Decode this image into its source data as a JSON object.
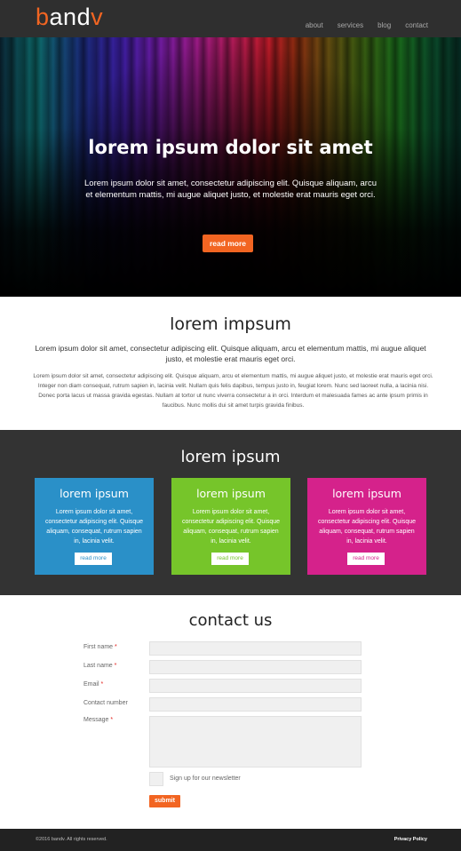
{
  "brand": {
    "logo_b": "b",
    "logo_and": "and",
    "logo_v": "v",
    "accent": "#f26522"
  },
  "nav": {
    "items": [
      "about",
      "services",
      "blog",
      "contact"
    ]
  },
  "hero": {
    "title": "lorem ipsum dolor sit amet",
    "text": "Lorem ipsum dolor sit amet, consectetur adipiscing elit. Quisque aliquam, arcu et elementum mattis, mi augue aliquet justo, et molestie erat mauris eget orci.",
    "button": "read more"
  },
  "intro": {
    "title": "lorem impsum",
    "lead": "Lorem ipsum dolor sit amet, consectetur adipiscing elit. Quisque aliquam, arcu et elementum mattis, mi augue aliquet justo, et molestie erat mauris eget orci.",
    "body": "Lorem ipsum dolor sit amet, consectetur adipiscing elit. Quisque aliquam, arcu et elementum mattis, mi augue aliquet justo, et molestie erat mauris eget orci. Integer non diam consequat, rutrum sapien in, lacinia velit. Nullam quis felis dapibus, tempus justo in, feugiat lorem. Nunc sed laoreet nulla, a lacinia nisi. Donec porta lacus ut massa gravida egestas. Nullam at tortor ut nunc viverra consectetur a in orci. Interdum et malesuada fames ac ante ipsum primis in faucibus. Nunc mollis dui sit amet turpis gravida finibus."
  },
  "services": {
    "title": "lorem ipsum",
    "cards": [
      {
        "title": "lorem ipsum",
        "text": "Lorem ipsum dolor sit amet, consectetur adipiscing elit. Quisque aliquam, consequat, rutrum sapien in, lacinia velit.",
        "button": "read more",
        "color": "#2a90c8"
      },
      {
        "title": "lorem ipsum",
        "text": "Lorem ipsum dolor sit amet, consectetur adipiscing elit. Quisque aliquam, consequat, rutrum sapien in, lacinia velit.",
        "button": "read more",
        "color": "#76c52a"
      },
      {
        "title": "lorem ipsum",
        "text": "Lorem ipsum dolor sit amet, consectetur adipiscing elit. Quisque aliquam, consequat, rutrum sapien in, lacinia velit.",
        "button": "read more",
        "color": "#d5228b"
      }
    ]
  },
  "contact": {
    "title": "contact us",
    "fields": [
      {
        "label": "First name",
        "required": true
      },
      {
        "label": "Last name",
        "required": true
      },
      {
        "label": "Email",
        "required": true
      },
      {
        "label": "Contact number",
        "required": false
      },
      {
        "label": "Message",
        "required": true
      }
    ],
    "required_mark": "*",
    "newsletter_label": "Sign up for our newsletter",
    "submit": "submit"
  },
  "footer": {
    "copyright": "©2016 bandv.   All rights reserved.",
    "privacy": "Privacy Policy"
  }
}
